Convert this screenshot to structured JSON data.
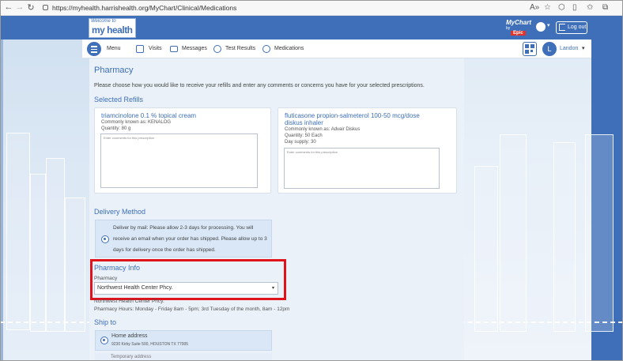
{
  "browser": {
    "url": "https://myhealth.harrishealth.org/MyChart/Clinical/Medications"
  },
  "header": {
    "logo_top": "Welcome to",
    "logo_main": "my health",
    "brand": "MyChart",
    "brand_sub": "by",
    "brand_epic": "Epic",
    "logout_label": "Log out"
  },
  "navbar": {
    "menu_label": "Menu",
    "items": [
      {
        "label": "Visits",
        "icon": "calendar-icon"
      },
      {
        "label": "Messages",
        "icon": "envelope-icon"
      },
      {
        "label": "Test Results",
        "icon": "flask-icon"
      },
      {
        "label": "Medications",
        "icon": "pill-icon"
      }
    ],
    "user_initial": "L",
    "user_name": "Landon"
  },
  "page": {
    "title": "Pharmacy",
    "intro": "Please choose how you would like to receive your refills and enter any comments or concerns you have for your selected prescriptions.",
    "selected_refills_heading": "Selected Refills",
    "refills": [
      {
        "name": "triamcinolone 0.1 % topical cream",
        "known_as": "Commonly known as: KENALOG",
        "quantity": "Quantity: 80 g",
        "comment_placeholder": "Enter comments for this prescription"
      },
      {
        "name": "fluticasone propion-salmeterol 100-50 mcg/dose diskus inhaler",
        "name_line1": "fluticasone propion-salmeterol 100-50 mcg/dose",
        "name_line2": "diskus inhaler",
        "known_as": "Commonly known as: Advair Diskus",
        "quantity": "Quantity: 50 Each",
        "day_supply": "Day supply: 30",
        "comment_placeholder": "Enter comments for this prescription"
      }
    ],
    "delivery_heading": "Delivery Method",
    "delivery_option": "Deliver by mail: Please allow 2-3 days for processing. You will receive an email when your order has shipped. Please allow up to 3 days for delivery once the order has shipped.",
    "pharmacy_info_heading": "Pharmacy Info",
    "pharmacy_label": "Pharmacy",
    "pharmacy_selected": "Northwest Health Center Phcy.",
    "pharmacy_name_line": "Northwest Health Center Phcy.",
    "pharmacy_hours": "Pharmacy Hours: Monday - Friday 8am - 5pm; 3rd Tuesday of the month, 8am - 12pm",
    "ship_to_heading": "Ship to",
    "home_label": "Home address",
    "home_address": "9230 Kirby Suite 500, HOUSTON TX 77005",
    "temp_label": "Temporary address"
  },
  "colors": {
    "accent": "#3e6fb8",
    "highlight": "#e1131a"
  }
}
